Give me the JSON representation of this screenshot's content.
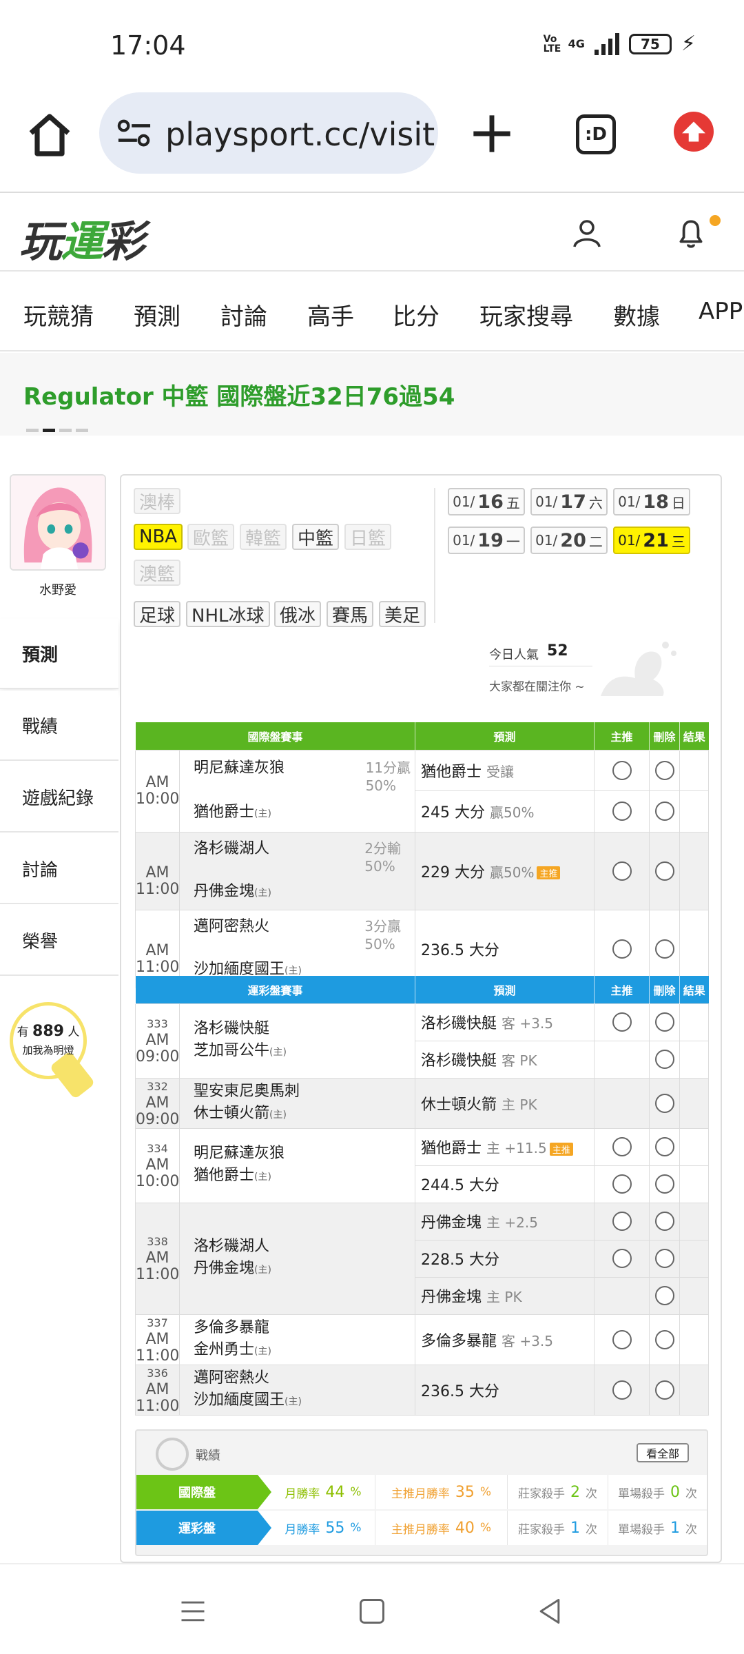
{
  "status_bar": {
    "time": "17:04",
    "network": "4G",
    "volte": "Vo LTE",
    "battery": "75"
  },
  "browser": {
    "url": "playsport.cc/visit",
    "tabs_label": ":D"
  },
  "site": {
    "logo_prefix": "玩",
    "logo_accent": "運",
    "logo_suffix": "彩"
  },
  "nav": {
    "items": [
      "玩競猜",
      "預測",
      "討論",
      "高手",
      "比分",
      "玩家搜尋",
      "數據",
      "APP"
    ]
  },
  "ticker": {
    "text": "Regulator 中籃 國際盤近32日76過54"
  },
  "sidebar": {
    "username": "水野愛",
    "tabs": [
      "預測",
      "戰績",
      "遊戲紀錄",
      "討論",
      "榮譽"
    ],
    "fans_prefix": "有",
    "fans_count": "889",
    "fans_suffix": "人",
    "fans_cta": "加我為明燈"
  },
  "sport_chips": {
    "row1": [
      "澳棒"
    ],
    "row2": [
      "NBA",
      "歐籃",
      "韓籃",
      "中籃",
      "日籃"
    ],
    "row3": [
      "澳籃"
    ],
    "row4": [
      "足球",
      "NHL冰球",
      "俄冰",
      "賽馬",
      "美足"
    ]
  },
  "dates": [
    {
      "md": "01/",
      "d": "16",
      "w": "五"
    },
    {
      "md": "01/",
      "d": "17",
      "w": "六"
    },
    {
      "md": "01/",
      "d": "18",
      "w": "日"
    },
    {
      "md": "01/",
      "d": "19",
      "w": "一"
    },
    {
      "md": "01/",
      "d": "20",
      "w": "二"
    },
    {
      "md": "01/",
      "d": "21",
      "w": "三"
    }
  ],
  "popularity": {
    "label": "今日人氣",
    "value": "52",
    "sub": "大家都在關注你 ~"
  },
  "intl_table": {
    "headers": [
      "國際盤賽事",
      "預測",
      "主推",
      "刪除",
      "結果"
    ],
    "home_mark": "(主)",
    "games": [
      {
        "time": "AM 10:00",
        "away": "明尼蘇達灰狼",
        "home": "猶他爵士",
        "odds1": "11分贏",
        "odds2": "50%",
        "pred1": "猶他爵士",
        "pred1_sub": "受讓",
        "pred2": "245 大分",
        "pred2_sub": "贏50%"
      },
      {
        "time": "AM 11:00",
        "away": "洛杉磯湖人",
        "home": "丹佛金塊",
        "odds1": "2分輸",
        "odds2": "50%",
        "pred1": "229 大分",
        "pred1_sub": "贏50%",
        "tag": "主推"
      },
      {
        "time": "AM 11:00",
        "away": "邁阿密熱火",
        "home": "沙加緬度國王",
        "odds1": "3分贏",
        "odds2": "50%",
        "pred1": "236.5 大分"
      }
    ]
  },
  "lottery_table": {
    "headers": [
      "運彩盤賽事",
      "預測",
      "主推",
      "刪除",
      "結果"
    ],
    "games": [
      {
        "no": "333",
        "time": "AM 09:00",
        "away": "洛杉磯快艇",
        "home": "芝加哥公牛",
        "p1": "洛杉磯快艇",
        "p1_sub": "客 +3.5",
        "p2": "洛杉磯快艇",
        "p2_sub": "客 PK"
      },
      {
        "no": "332",
        "time": "AM 09:00",
        "away": "聖安東尼奧馬刺",
        "home": "休士頓火箭",
        "p1": "休士頓火箭",
        "p1_sub": "主 PK"
      },
      {
        "no": "334",
        "time": "AM 10:00",
        "away": "明尼蘇達灰狼",
        "home": "猶他爵士",
        "p1": "猶他爵士",
        "p1_sub": "主 +11.5",
        "tag": "主推",
        "p2": "244.5 大分"
      },
      {
        "no": "338",
        "time": "AM 11:00",
        "away": "洛杉磯湖人",
        "home": "丹佛金塊",
        "p1": "丹佛金塊",
        "p1_sub": "主 +2.5",
        "p2": "228.5 大分",
        "p3": "丹佛金塊",
        "p3_sub": "主 PK"
      },
      {
        "no": "337",
        "time": "AM 11:00",
        "away": "多倫多暴龍",
        "home": "金州勇士",
        "p1": "多倫多暴龍",
        "p1_sub": "客 +3.5"
      },
      {
        "no": "336",
        "time": "AM 11:00",
        "away": "邁阿密熱火",
        "home": "沙加緬度國王",
        "p1": "236.5 大分"
      }
    ]
  },
  "record": {
    "title": "戰績",
    "view_all": "看全部",
    "rows": [
      {
        "label": "國際盤",
        "c1_label": "月勝率",
        "c1_val": "44",
        "c2_label": "主推月勝率",
        "c2_val": "35",
        "pct": "%",
        "c3_label": "莊家殺手",
        "c3_val": "2",
        "c4_label": "單場殺手",
        "c4_val": "0",
        "unit": "次",
        "color": "#6cc416"
      },
      {
        "label": "運彩盤",
        "c1_label": "月勝率",
        "c1_val": "55",
        "c2_label": "主推月勝率",
        "c2_val": "40",
        "pct": "%",
        "c3_label": "莊家殺手",
        "c3_val": "1",
        "c4_label": "單場殺手",
        "c4_val": "1",
        "unit": "次",
        "color": "#1e9be0"
      }
    ]
  }
}
